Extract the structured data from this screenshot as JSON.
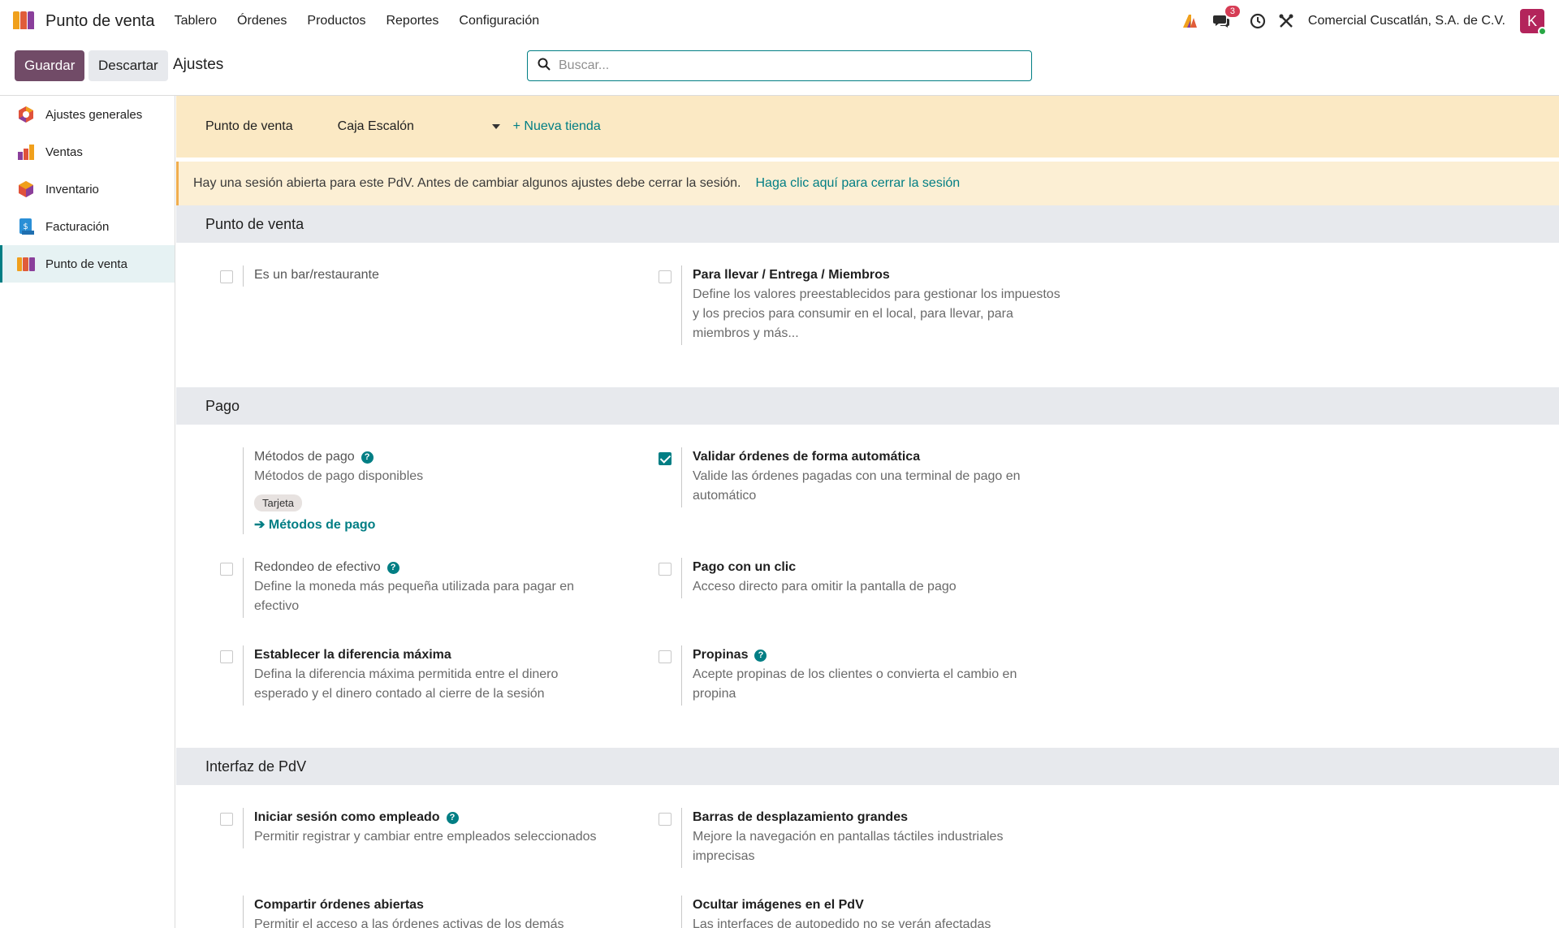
{
  "topbar": {
    "app_name": "Punto de venta",
    "menu": [
      "Tablero",
      "Órdenes",
      "Productos",
      "Reportes",
      "Configuración"
    ],
    "messages_count": "3",
    "company": "Comercial Cuscatlán, S.A. de C.V.",
    "avatar_letter": "K"
  },
  "controlbar": {
    "save_label": "Guardar",
    "discard_label": "Descartar",
    "breadcrumb": "Ajustes",
    "search_placeholder": "Buscar..."
  },
  "sidebar": {
    "items": [
      {
        "label": "Ajustes generales",
        "icon": "settings-app-icon"
      },
      {
        "label": "Ventas",
        "icon": "sales-app-icon"
      },
      {
        "label": "Inventario",
        "icon": "inventory-app-icon"
      },
      {
        "label": "Facturación",
        "icon": "invoicing-app-icon"
      },
      {
        "label": "Punto de venta",
        "icon": "pos-app-icon"
      }
    ]
  },
  "store_bar": {
    "label": "Punto de venta",
    "selected": "Caja Escalón",
    "new_store": "+ Nueva tienda"
  },
  "alert": {
    "text": "Hay una sesión abierta para este PdV. Antes de cambiar algunos ajustes debe cerrar la sesión.",
    "link": "Haga clic aquí para cerrar la sesión"
  },
  "sections": {
    "pos": {
      "title": "Punto de venta",
      "bar": {
        "title": "Es un bar/restaurante"
      },
      "takeaway": {
        "title": "Para llevar / Entrega / Miembros",
        "desc": "Define los valores preestablecidos para gestionar los impuestos y los precios para consumir en el local, para llevar, para miembros y más..."
      }
    },
    "payment": {
      "title": "Pago",
      "methods": {
        "title": "Métodos de pago",
        "desc": "Métodos de pago disponibles",
        "tag": "Tarjeta",
        "link": "Métodos de pago"
      },
      "auto_validate": {
        "title": "Validar órdenes de forma automática",
        "desc": "Valide las órdenes pagadas con una terminal de pago en automático",
        "checked": true
      },
      "rounding": {
        "title": "Redondeo de efectivo",
        "desc": "Define la moneda más pequeña utilizada para pagar en efectivo"
      },
      "one_click": {
        "title": "Pago con un clic",
        "desc": "Acceso directo para omitir la pantalla de pago"
      },
      "max_diff": {
        "title": "Establecer la diferencia máxima",
        "desc": "Defina la diferencia máxima permitida entre el dinero esperado y el dinero contado al cierre de la sesión"
      },
      "tips": {
        "title": "Propinas",
        "desc": "Acepte propinas de los clientes o convierta el cambio en propina"
      }
    },
    "interface": {
      "title": "Interfaz de PdV",
      "employee_login": {
        "title": "Iniciar sesión como empleado",
        "desc": "Permitir registrar y cambiar entre empleados seleccionados"
      },
      "scrollbars": {
        "title": "Barras de desplazamiento grandes",
        "desc": "Mejore la navegación en pantallas táctiles industriales imprecisas"
      },
      "share_orders": {
        "title": "Compartir órdenes abiertas",
        "desc": "Permitir el acceso a las órdenes activas de los demás"
      },
      "hide_images": {
        "title": "Ocultar imágenes en el PdV",
        "desc": "Las interfaces de autopedido no se verán afectadas"
      }
    }
  }
}
